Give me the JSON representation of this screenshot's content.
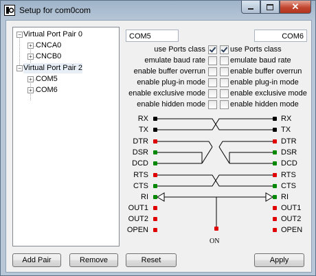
{
  "window": {
    "title": "Setup for com0com"
  },
  "tree": {
    "items": [
      {
        "label": "Virtual Port Pair 0",
        "level": 0
      },
      {
        "label": "CNCA0",
        "level": 1
      },
      {
        "label": "CNCB0",
        "level": 1
      },
      {
        "label": "Virtual Port Pair 2",
        "level": 0
      },
      {
        "label": "COM5",
        "level": 1
      },
      {
        "label": "COM6",
        "level": 1
      }
    ]
  },
  "ports": {
    "left_name": "COM5",
    "right_name": "COM6"
  },
  "options": [
    {
      "left": "use Ports class",
      "right": "use Ports class",
      "left_checked": true,
      "right_checked": true
    },
    {
      "left": "emulate baud rate",
      "right": "emulate baud rate",
      "left_checked": false,
      "right_checked": false
    },
    {
      "left": "enable buffer overrun",
      "right": "enable buffer overrun",
      "left_checked": false,
      "right_checked": false
    },
    {
      "left": "enable plug-in mode",
      "right": "enable plug-in mode",
      "left_checked": false,
      "right_checked": false
    },
    {
      "left": "enable exclusive mode",
      "right": "enable exclusive mode",
      "left_checked": false,
      "right_checked": false
    },
    {
      "left": "enable hidden mode",
      "right": "enable hidden mode",
      "left_checked": false,
      "right_checked": false
    }
  ],
  "signals": {
    "left": [
      {
        "label": "RX",
        "color": "#000000"
      },
      {
        "label": "TX",
        "color": "#000000"
      },
      {
        "label": "DTR",
        "color": "#e00000"
      },
      {
        "label": "DSR",
        "color": "#008800"
      },
      {
        "label": "DCD",
        "color": "#008800"
      },
      {
        "label": "RTS",
        "color": "#e00000"
      },
      {
        "label": "CTS",
        "color": "#008800"
      },
      {
        "label": "RI",
        "color": "#008800"
      },
      {
        "label": "OUT1",
        "color": "#e00000"
      },
      {
        "label": "OUT2",
        "color": "#e00000"
      },
      {
        "label": "OPEN",
        "color": "#e00000"
      }
    ],
    "right": [
      {
        "label": "RX",
        "color": "#000000"
      },
      {
        "label": "TX",
        "color": "#000000"
      },
      {
        "label": "DTR",
        "color": "#e00000"
      },
      {
        "label": "DSR",
        "color": "#008800"
      },
      {
        "label": "DCD",
        "color": "#008800"
      },
      {
        "label": "RTS",
        "color": "#e00000"
      },
      {
        "label": "CTS",
        "color": "#008800"
      },
      {
        "label": "RI",
        "color": "#008800"
      },
      {
        "label": "OUT1",
        "color": "#e00000"
      },
      {
        "label": "OUT2",
        "color": "#e00000"
      },
      {
        "label": "OPEN",
        "color": "#e00000"
      }
    ],
    "on_label": "ON"
  },
  "buttons": {
    "add_pair": "Add Pair",
    "remove": "Remove",
    "reset": "Reset",
    "apply": "Apply"
  },
  "colors": {
    "titlebar": "#b7c7d8",
    "close": "#c1462f"
  },
  "icons": {
    "app": "com0com-app-icon",
    "minimize": "minimize-icon",
    "maximize": "maximize-icon",
    "close": "close-icon"
  }
}
